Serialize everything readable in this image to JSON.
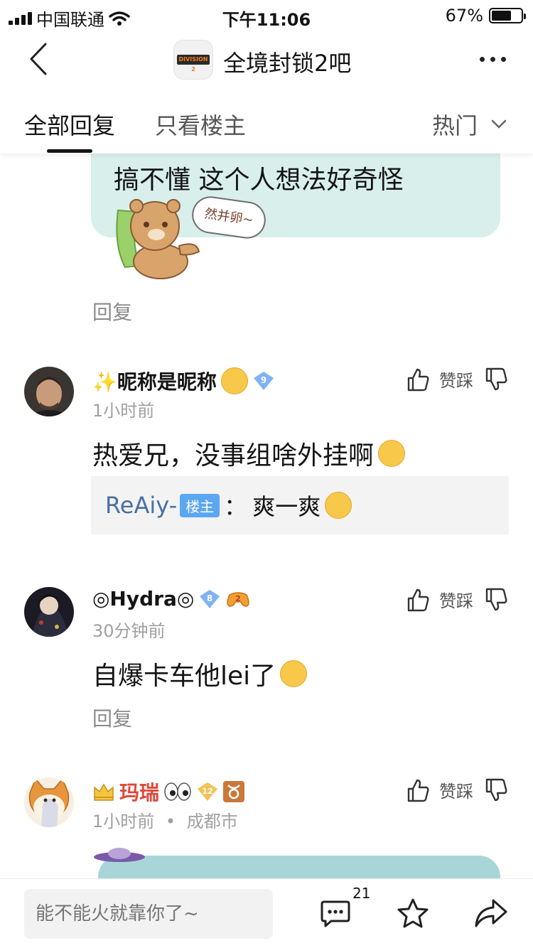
{
  "status_bar": {
    "carrier": "中国联通",
    "time": "下午11:06",
    "battery": "67%",
    "battery_level": 0.67
  },
  "nav": {
    "forum_name": "全境封锁2吧",
    "logo_text": "DIVISION 2"
  },
  "tabs": {
    "all": "全部回复",
    "owner": "只看楼主",
    "sort": "热门"
  },
  "quoted_post": {
    "text": "搞不懂 这个人想法好奇怪",
    "sticker_caption": "然并卵~",
    "reply_label": "回复"
  },
  "comments": [
    {
      "username": "✨昵称是昵称",
      "level": "9",
      "time": "1小时前",
      "like_label": "赞踩",
      "text": "热爱兄，没事组啥外挂啊",
      "sub_reply": {
        "author": "ReAiy-",
        "badge": "楼主",
        "colon": "：",
        "text": "爽一爽"
      }
    },
    {
      "username": "◎Hydra◎",
      "level": "8",
      "time": "30分钟前",
      "like_label": "赞踩",
      "text": "自爆卡车他lei了",
      "reply_label": "回复"
    },
    {
      "username": "玛瑞",
      "level": "12",
      "time": "1小时前",
      "location_sep": "•",
      "location": "成都市",
      "like_label": "赞踩"
    }
  ],
  "bottom": {
    "placeholder": "能不能火就靠你了~",
    "comment_count": "21"
  }
}
